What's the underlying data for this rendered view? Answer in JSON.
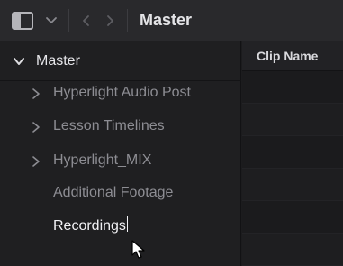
{
  "toolbar": {
    "sidebar_toggle_icon": "sidebar-toggle-icon",
    "dropdown_icon": "chevron-down-icon",
    "back_icon": "chevron-left-icon",
    "forward_icon": "chevron-right-icon",
    "title": "Master"
  },
  "sidebar": {
    "root": {
      "label": "Master",
      "icon": "chevron-down-icon",
      "expanded": true
    },
    "items": [
      {
        "label": "Hyperlight Audio Post",
        "has_children": true
      },
      {
        "label": "Lesson Timelines",
        "has_children": true
      },
      {
        "label": "Hyperlight_MIX",
        "has_children": true
      },
      {
        "label": "Additional Footage",
        "has_children": false
      },
      {
        "label": "Recordings",
        "has_children": false,
        "editing": true
      }
    ]
  },
  "cliplist": {
    "column_header": "Clip Name"
  },
  "colors": {
    "background": "#1c1c1e",
    "toolbar": "#29292c",
    "text_active": "#e6e6ea",
    "text_muted": "#8d8d93"
  }
}
